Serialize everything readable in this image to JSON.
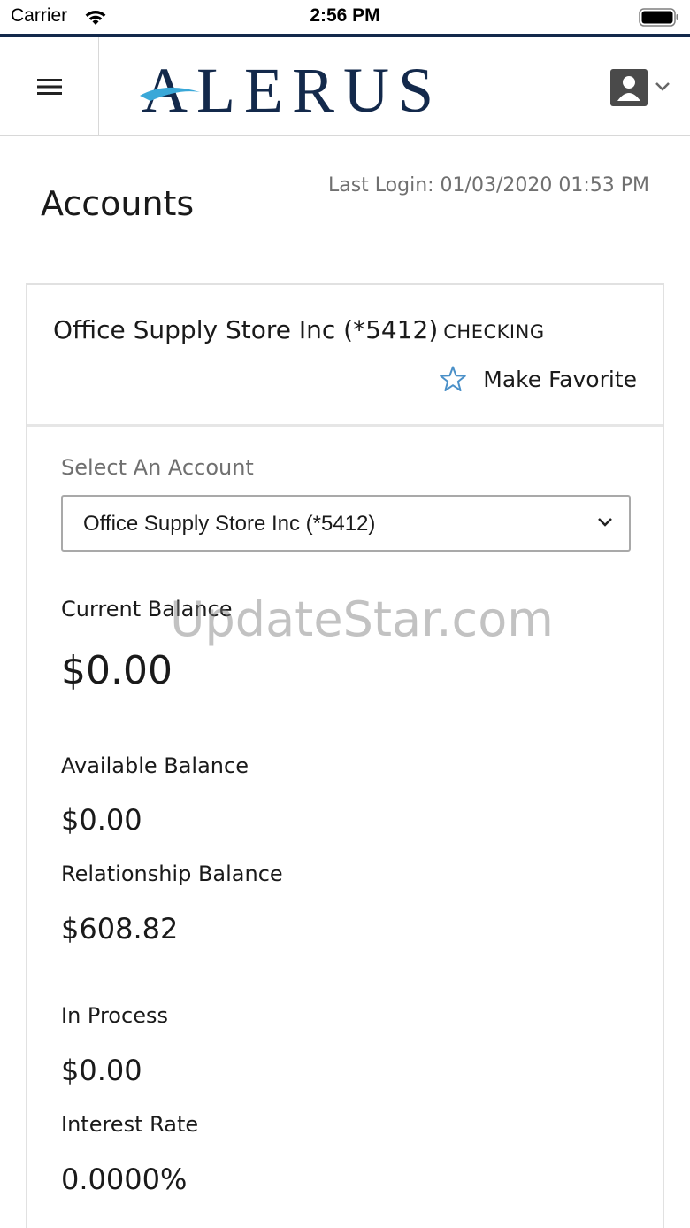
{
  "status_bar": {
    "carrier": "Carrier",
    "time": "2:56 PM"
  },
  "header": {
    "brand": "ALERUS",
    "brand_color": "#13294b",
    "accent_color": "#3aa8d8"
  },
  "page": {
    "title": "Accounts",
    "last_login": "Last Login: 01/03/2020 01:53 PM"
  },
  "account": {
    "name": "Office Supply Store Inc (*5412)",
    "type": "CHECKING",
    "favorite_label": "Make Favorite",
    "select_label": "Select An Account",
    "selected_option": "Office Supply Store Inc (*5412)",
    "current_balance_label": "Current Balance",
    "current_balance": "$0.00",
    "available_balance_label": "Available Balance",
    "available_balance": "$0.00",
    "relationship_balance_label": "Relationship Balance",
    "relationship_balance": "$608.82",
    "in_process_label": "In Process",
    "in_process": "$0.00",
    "interest_rate_label": "Interest Rate",
    "interest_rate": "0.0000%"
  },
  "watermark": "UpdateStar.com"
}
